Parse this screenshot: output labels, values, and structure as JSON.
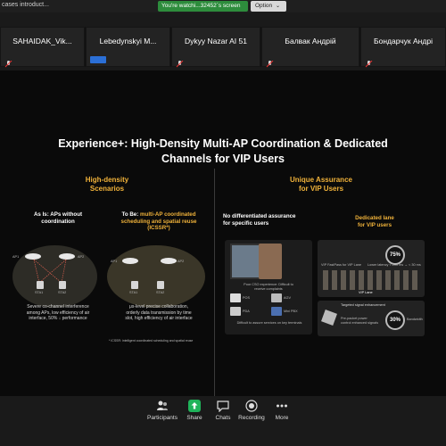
{
  "topbar": {
    "case_text": "cases introduct...",
    "share_status": "You're watchi...32452`s screen",
    "option_label": "Option"
  },
  "participants": [
    {
      "name": "SAHAIDAK_Vik..."
    },
    {
      "name": "Lebedynskyi M..."
    },
    {
      "name": "Dykyy Nazar AI 51"
    },
    {
      "name": "Балвак Андрій"
    },
    {
      "name": "Бондарчук Андрі"
    }
  ],
  "slide": {
    "title_line1": "Experience+: High-Density Multi-AP Coordination & Dedicated",
    "title_line2": "Channels for VIP Users",
    "left": {
      "title_line1": "High-density",
      "title_line2": "Scenarios",
      "as_is_line1": "As Is: APs without",
      "as_is_line2": "coordination",
      "to_be_line1": "To Be:",
      "to_be_line1b": "multi-AP coordinated",
      "to_be_line2": "scheduling and spatial reuse",
      "to_be_line3": "(ICSSR*)",
      "ap1": "AP1",
      "ap2": "AP2",
      "sta1": "STA1",
      "sta2": "STA2",
      "as_is_desc1": "Severe co-channel interference",
      "as_is_desc2": "among APs, low efficiency of air",
      "as_is_desc3": "interface, 50% ↓ performance",
      "to_be_desc1": "μs-level precise collaboration,",
      "to_be_desc2": "orderly data transmission by time",
      "to_be_desc3": "slot, high efficiency of air interface",
      "footnote": "* ICSSR: intelligent coordinated scheduling and spatial reuse"
    },
    "right": {
      "title_line1": "Unique Assurance",
      "title_line2": "for VIP Users",
      "no_diff_line1": "No differentiated assurance",
      "no_diff_line2": "for specific users",
      "dedicated_line1": "Dedicated lane",
      "dedicated_line2": "for VIP users",
      "poor_cso_line1": "Poor CSO experience: Difficult to",
      "poor_cso_line2": "receive complaints",
      "pos": "POS",
      "agv": "AGV",
      "pda": "PDA",
      "mini": "Mini PBX",
      "difficult": "Difficult to assure services on key terminals",
      "vip_fastpass": "VIP FastPass for VIP Lane",
      "latency": "Lower latency < 200 ms → < 30 ms",
      "pct75": "75%",
      "vip_lane": "VIP Lane",
      "targeted": "Targeted signal enhancement",
      "pct30": "30%",
      "pre_packet": "Pre-packet power control enhanced signals",
      "bandwidth": "Bandwidth"
    }
  },
  "toolbar": {
    "participants": "Participants",
    "participants_count": "34",
    "share": "Share",
    "chats": "Chats",
    "recording": "Recording",
    "more": "More"
  },
  "colors": {
    "accent": "#f0b23a",
    "share_green": "#1fb35a",
    "status_green": "#2d8c3c"
  }
}
